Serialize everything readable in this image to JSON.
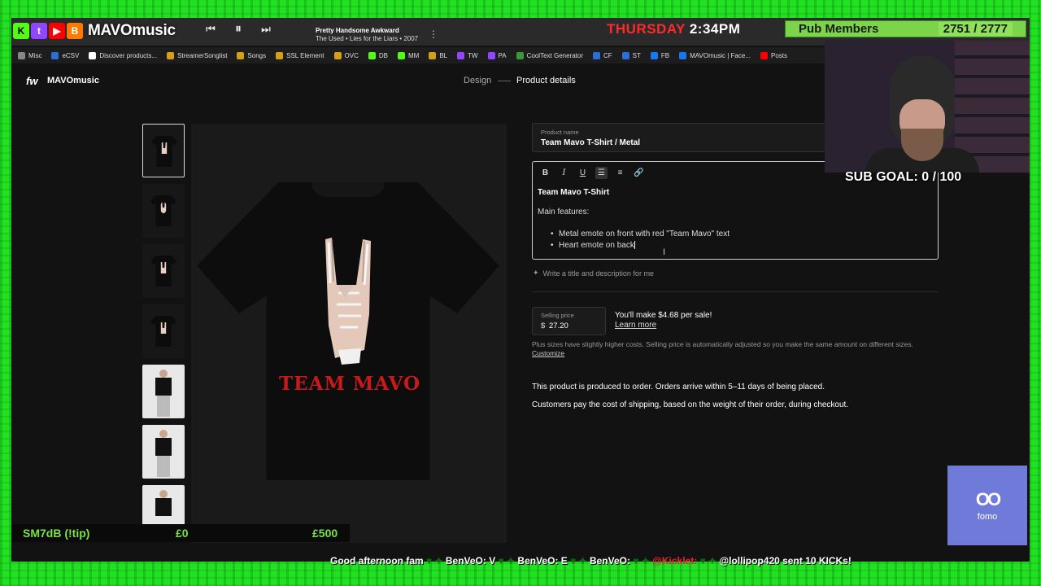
{
  "stream": {
    "brand": "MAVOmusic",
    "day": "THURSDAY",
    "time": "2:34PM",
    "pub_members_label": "Pub Members",
    "pub_members_count": "2751 / 2777",
    "sub_goal": "SUB GOAL: 0 / 100",
    "tip_label": "SM7dB (!tip)",
    "tip_current": "£0",
    "tip_goal": "£500",
    "ticker_text": "Good afternoon fam",
    "ticker_items": [
      "BenVeO: V",
      "BenVeO: E",
      "BenVeO:",
      "@Kicklet:",
      "@lollipop420 sent 10 KICKs!"
    ],
    "fomo_label": "fomo"
  },
  "player": {
    "song_title": "Pretty Handsome Awkward",
    "song_artist": "The Used • Lies for the Liars • 2007"
  },
  "bookmarks": [
    {
      "label": "Misc",
      "color": "#888888"
    },
    {
      "label": "eCSV",
      "color": "#2a6fd6"
    },
    {
      "label": "Discover products...",
      "color": "#ffffff"
    },
    {
      "label": "StreamerSonglist",
      "color": "#d4a017"
    },
    {
      "label": "Songs",
      "color": "#d4a017"
    },
    {
      "label": "SSL Element",
      "color": "#d4a017"
    },
    {
      "label": "OVC",
      "color": "#d4a017"
    },
    {
      "label": "DB",
      "color": "#53fc18"
    },
    {
      "label": "MM",
      "color": "#53fc18"
    },
    {
      "label": "BL",
      "color": "#d4a017"
    },
    {
      "label": "TW",
      "color": "#9146ff"
    },
    {
      "label": "PA",
      "color": "#9146ff"
    },
    {
      "label": "CoolText Generator",
      "color": "#3a9a3a"
    },
    {
      "label": "CF",
      "color": "#2a6fd6"
    },
    {
      "label": "ST",
      "color": "#2a6fd6"
    },
    {
      "label": "FB",
      "color": "#1877f2"
    },
    {
      "label": "MAVOmusic | Face...",
      "color": "#1877f2"
    },
    {
      "label": "Posts",
      "color": "#ff0000"
    }
  ],
  "app": {
    "logo": "fw",
    "shop_name": "MAVOmusic",
    "step_design": "Design",
    "step_details": "Product details"
  },
  "product": {
    "name_label": "Product name",
    "name_value": "Team Mavo T-Shirt / Metal",
    "print_text": "TEAM MAVO",
    "desc_title": "Team Mavo T-Shirt",
    "desc_main": "Main features:",
    "desc_bullets": [
      "Metal emote on front with red \"Team Mavo\" text",
      "Heart emote on back"
    ],
    "ai_prompt": "Write a title and description for me",
    "price_label": "Selling price",
    "currency": "$",
    "price_value": "27.20",
    "earnings": "You'll make $4.68 per sale!",
    "learn_more": "Learn more",
    "plus_note": "Plus sizes have slightly higher costs. Selling price is automatically adjusted so you make the same amount on different sizes.",
    "customize": "Customize",
    "produced_note": "This product is produced to order. Orders arrive within 5–11 days of being placed.",
    "shipping_note": "Customers pay the cost of shipping, based on the weight of their order, during checkout."
  },
  "colors": {
    "frame_green": "#22e022",
    "logo_red": "#c81a1a",
    "fomo_bg": "#6f7ad9",
    "pub_green": "#7bd44a"
  }
}
